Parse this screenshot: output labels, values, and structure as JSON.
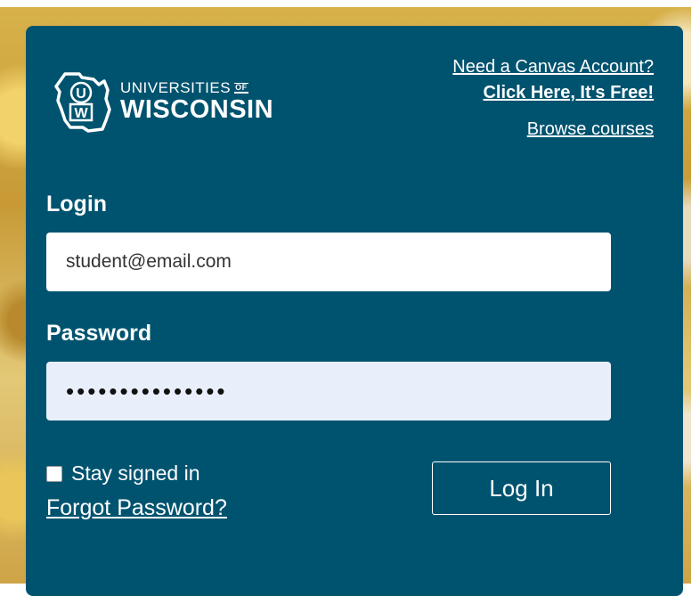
{
  "logo": {
    "line1": "UNIVERSITIES",
    "of": "OF",
    "line2": "WISCONSIN",
    "mark_u": "U",
    "mark_w": "W"
  },
  "links": {
    "need_account": "Need a Canvas Account?",
    "click_here": "Click Here, It's Free!",
    "browse": "Browse courses"
  },
  "form": {
    "login_label": "Login",
    "login_value": "student@email.com",
    "password_label": "Password",
    "password_masked": "•••••••••••••••",
    "stay_signed_in": "Stay signed in",
    "forgot_password": "Forgot Password?",
    "login_button": "Log In"
  },
  "colors": {
    "panel": "#00536f",
    "password_field": "#e8effb"
  }
}
